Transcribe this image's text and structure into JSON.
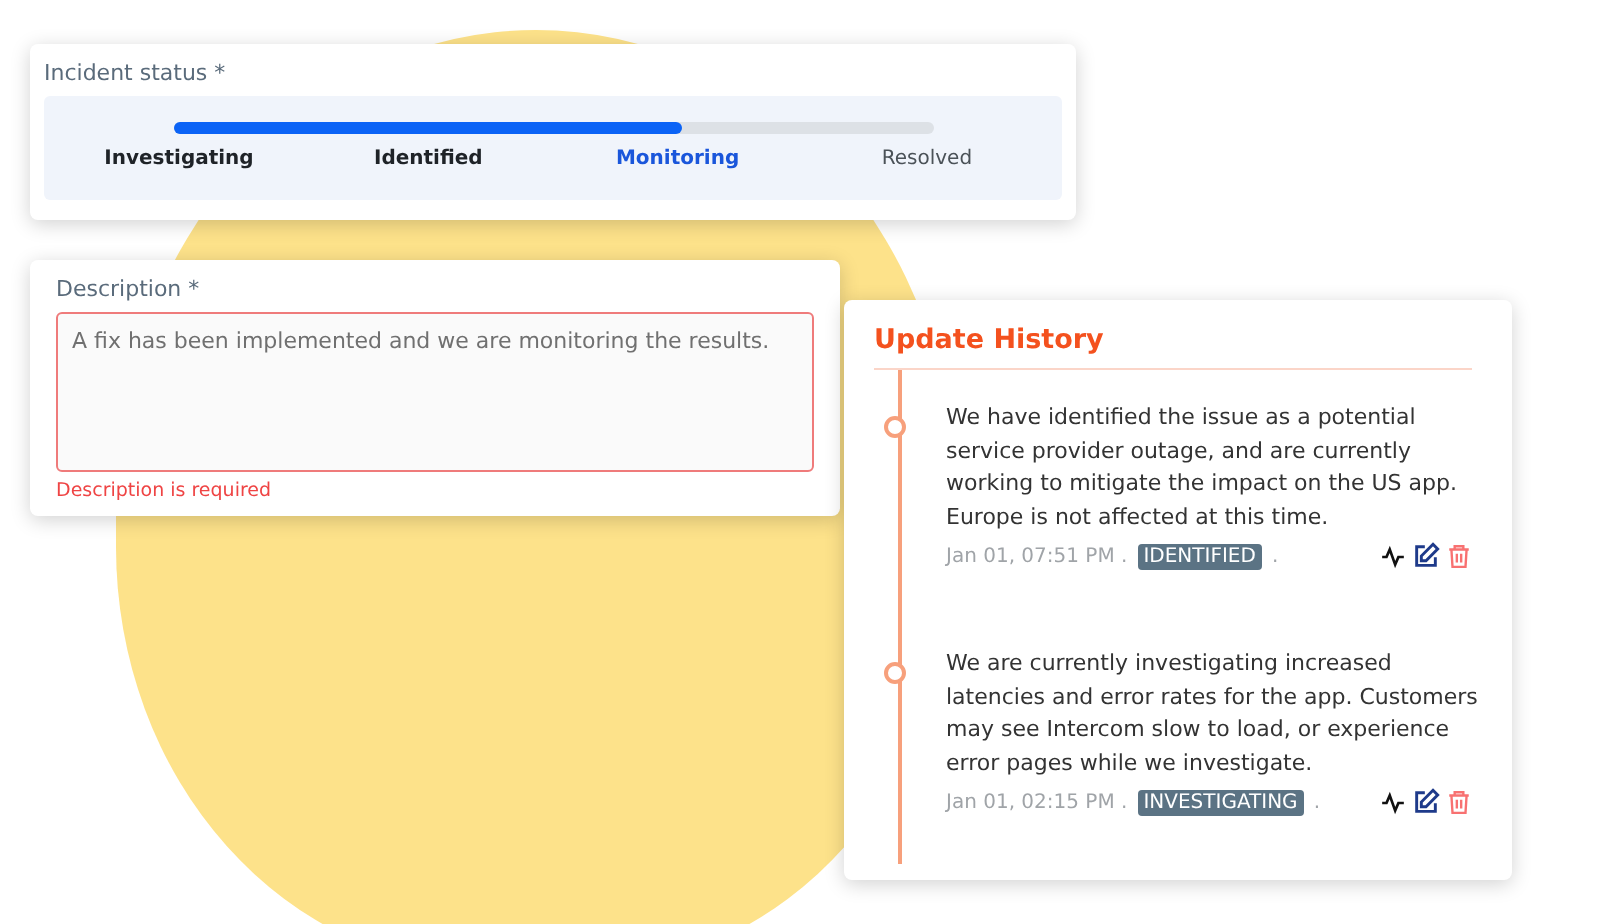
{
  "incident_status": {
    "label": "Incident status *",
    "level": 0.67,
    "steps": [
      {
        "label": "Investigating",
        "done": true,
        "selected": false
      },
      {
        "label": "Identified",
        "done": true,
        "selected": false
      },
      {
        "label": "Monitoring",
        "done": false,
        "selected": true
      },
      {
        "label": "Resolved",
        "done": false,
        "selected": false
      }
    ]
  },
  "description": {
    "label": "Description *",
    "value": "A fix has been implemented and we are monitoring the results.",
    "error": "Description is required"
  },
  "update_history": {
    "title": "Update History",
    "entries": [
      {
        "text": "We have identified the issue as a potential service provider outage, and are currently working to mitigate the impact on the US app. Europe is not affected at this time.",
        "time": "Jan 01, 07:51 PM .",
        "status": "IDENTIFIED",
        "separator": "."
      },
      {
        "text": "We are currently investigating increased latencies and error rates for the app. Customers may see Intercom slow to load, or experience error pages while we investigate.",
        "time": "Jan 01, 02:15 PM .",
        "status": "INVESTIGATING",
        "separator": "."
      }
    ]
  }
}
